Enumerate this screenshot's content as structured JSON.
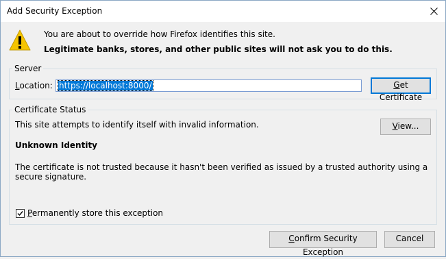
{
  "window": {
    "title": "Add Security Exception"
  },
  "intro": {
    "line1": "You are about to override how Firefox identifies this site.",
    "line2": "Legitimate banks, stores, and other public sites will not ask you to do this."
  },
  "server": {
    "legend": "Server",
    "location_label": "Location:",
    "location_value": "https://localhost:8000/",
    "get_certificate_label": "Get Certificate"
  },
  "certificate_status": {
    "legend": "Certificate Status",
    "status_text": "This site attempts to identify itself with invalid information.",
    "view_label": "View...",
    "identity_heading": "Unknown Identity",
    "description": "The certificate is not trusted because it hasn't been verified as issued by a trusted authority using a secure signature."
  },
  "permanent": {
    "label": "Permanently store this exception",
    "checked": true
  },
  "buttons": {
    "confirm_label": "Confirm Security Exception",
    "cancel_label": "Cancel"
  },
  "colors": {
    "accent": "#0078d7",
    "warning": "#f5c400"
  }
}
